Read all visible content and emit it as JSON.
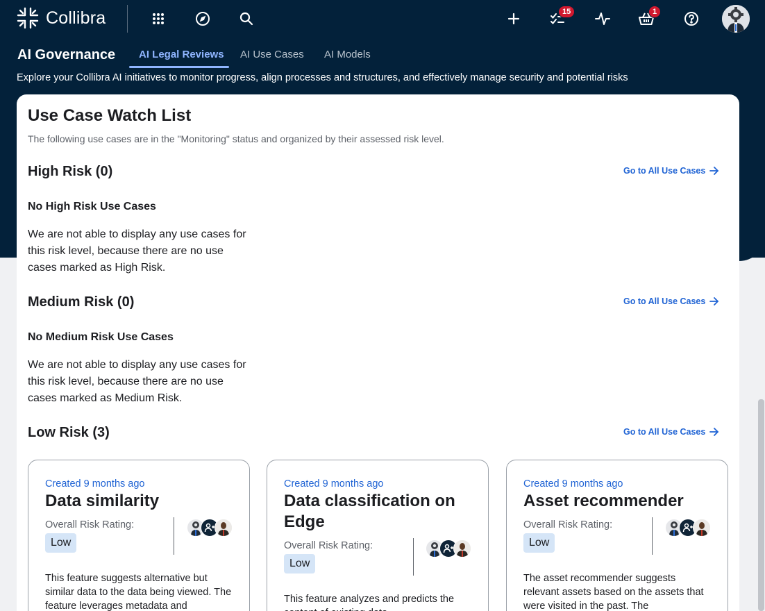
{
  "app": {
    "brand": "Collibra"
  },
  "topbar": {
    "tasks_badge": "15",
    "cart_badge": "1"
  },
  "header": {
    "section_title": "AI Governance",
    "tabs": [
      {
        "label": "AI Legal Reviews",
        "active": true
      },
      {
        "label": "AI Use Cases",
        "active": false
      },
      {
        "label": "AI Models",
        "active": false
      }
    ],
    "subtitle": "Explore your Collibra AI initiatives to monitor progress, align processes and structures, and effectively manage security and potential risks"
  },
  "watchlist": {
    "title": "Use Case Watch List",
    "description": "The following use cases are in the \"Monitoring\" status and organized by their assessed risk level.",
    "link_label": "Go to All Use Cases",
    "high": {
      "heading": "High Risk (0)",
      "empty_title": "No High Risk Use Cases",
      "empty_text": "We are not able to display any use cases for this risk level, because there are no use cases marked as High Risk."
    },
    "medium": {
      "heading": "Medium Risk (0)",
      "empty_title": "No Medium Risk Use Cases",
      "empty_text": "We are not able to display any use cases for this risk level, because there are no use cases marked as Medium Risk."
    },
    "low": {
      "heading": "Low Risk (3)",
      "cards": [
        {
          "created": "Created 9 months ago",
          "title": "Data similarity",
          "rating_label": "Overall Risk Rating:",
          "rating": "Low",
          "description": "This feature suggests alternative but similar data to the data being viewed. The feature leverages metadata and"
        },
        {
          "created": "Created 9 months ago",
          "title": "Data classification on Edge",
          "rating_label": "Overall Risk Rating:",
          "rating": "Low",
          "description": "This feature analyzes and predicts the content of existing data"
        },
        {
          "created": "Created 9 months ago",
          "title": "Asset recommender",
          "rating_label": "Overall Risk Rating:",
          "rating": "Low",
          "description": "The asset recommender suggests relevant assets based on the assets that were visited in the past. The"
        }
      ]
    }
  },
  "colors": {
    "navy": "#03213a",
    "link": "#1f63d4",
    "tab_active": "#8fb5ff",
    "badge": "#d1182e",
    "pill": "#d5e5f7"
  }
}
